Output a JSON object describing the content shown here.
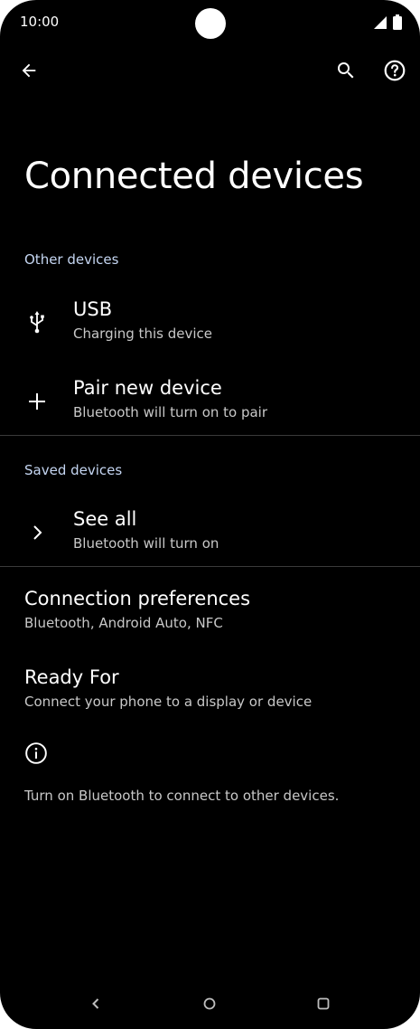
{
  "status_bar": {
    "time": "10:00",
    "signal_icon": "signal-icon",
    "battery_icon": "battery-icon"
  },
  "app_bar": {
    "back_icon": "back-arrow-icon",
    "search_icon": "search-icon",
    "help_icon": "help-icon"
  },
  "page": {
    "title": "Connected devices"
  },
  "sections": {
    "other_devices": {
      "header": "Other devices",
      "items": [
        {
          "icon": "usb-icon",
          "title": "USB",
          "subtitle": "Charging this device"
        },
        {
          "icon": "plus-icon",
          "title": "Pair new device",
          "subtitle": "Bluetooth will turn on to pair"
        }
      ]
    },
    "saved_devices": {
      "header": "Saved devices",
      "items": [
        {
          "icon": "chevron-right-icon",
          "title": "See all",
          "subtitle": "Bluetooth will turn on"
        }
      ]
    },
    "more": {
      "items": [
        {
          "title": "Connection preferences",
          "subtitle": "Bluetooth, Android Auto, NFC"
        },
        {
          "title": "Ready For",
          "subtitle": "Connect your phone to a display or device"
        }
      ]
    }
  },
  "footer": {
    "icon": "info-icon",
    "text": "Turn on Bluetooth to connect to other devices."
  },
  "nav_bar": {
    "back_icon": "nav-back-icon",
    "home_icon": "nav-home-icon",
    "recents_icon": "nav-recents-icon"
  },
  "colors": {
    "background": "#000000",
    "text_primary": "#ffffff",
    "text_secondary": "#c8c8c8",
    "section_header": "#c5d6f2",
    "divider": "#3a3a3a"
  }
}
